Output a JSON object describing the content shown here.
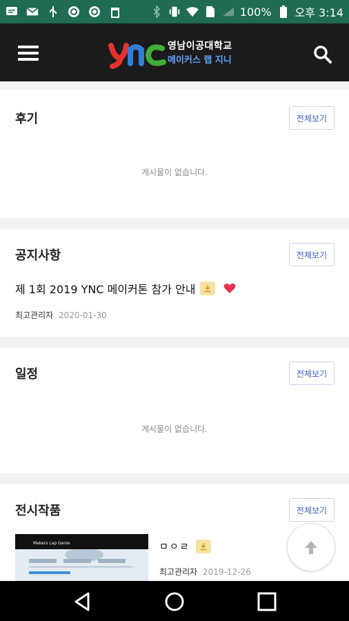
{
  "status_bar": {
    "battery": "100%",
    "time": "오후 3:14"
  },
  "header": {
    "logo_line1": "영남이공대학교",
    "logo_line2": "메이커스 랩 지니"
  },
  "sections": {
    "review": {
      "title": "후기",
      "more_label": "전체보기",
      "empty_text": "게시물이 없습니다."
    },
    "notice": {
      "title": "공지사항",
      "more_label": "전체보기",
      "post_title": "제 1회 2019 YNC 메이커톤 참가 안내",
      "post_author": "최고관리자",
      "post_date": "2020-01-30"
    },
    "schedule": {
      "title": "일정",
      "more_label": "전체보기",
      "empty_text": "게시물이 없습니다."
    },
    "gallery": {
      "title": "전시작품",
      "more_label": "전체보기",
      "item_title": "ㅁㅇㄹ",
      "item_author": "최고관리자",
      "item_date": "2019-12-26",
      "thumb_caption": "Makers Lap Genie"
    }
  },
  "colors": {
    "status_bar": "#1f6b53",
    "header_bg": "#1b1b1b",
    "button_text": "#3a62c8",
    "heart": "#e8334a"
  }
}
